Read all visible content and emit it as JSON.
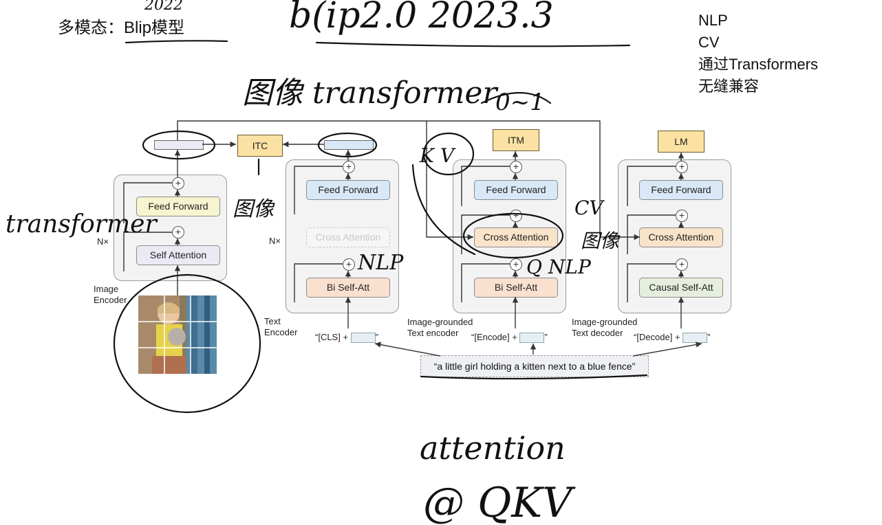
{
  "header": {
    "title": "多模态：Blip模型"
  },
  "side_notes": [
    "NLP",
    "CV",
    "通过Transformers",
    "无缝兼容"
  ],
  "encoder1": {
    "feed_forward": "Feed Forward",
    "self_attention": "Self Attention",
    "repeat": "N×",
    "name": "Image\nEncoder"
  },
  "encoder2": {
    "feed_forward": "Feed Forward",
    "cross_attention": "Cross Attention",
    "self_att": "Bi Self-Att",
    "repeat": "N×",
    "name": "Text\nEncoder",
    "input": "“[CLS] +",
    "input_end": "”"
  },
  "encoder3": {
    "feed_forward": "Feed Forward",
    "cross_attention": "Cross Attention",
    "self_att": "Bi Self-Att",
    "name": "Image-grounded\nText encoder",
    "input": "“[Encode] +",
    "input_end": "”"
  },
  "decoder": {
    "feed_forward": "Feed Forward",
    "cross_attention": "Cross Attention",
    "self_att": "Causal Self-Att",
    "name": "Image-grounded\nText decoder",
    "input": "“[Decode] +",
    "input_end": "”"
  },
  "outputs": {
    "itc": "ITC",
    "itm": "ITM",
    "lm": "LM"
  },
  "caption": "“a little girl holding a kitten next to a blue fence”",
  "icons": [
    "plus-icon"
  ],
  "colors": {
    "feed_forward_yellow": "#f7f5cf",
    "feed_forward_blue": "#d8e8f7",
    "self_att_orange": "#f9e0cf",
    "output_gold": "#fbe1a3",
    "causal_green": "#e6efdd"
  }
}
